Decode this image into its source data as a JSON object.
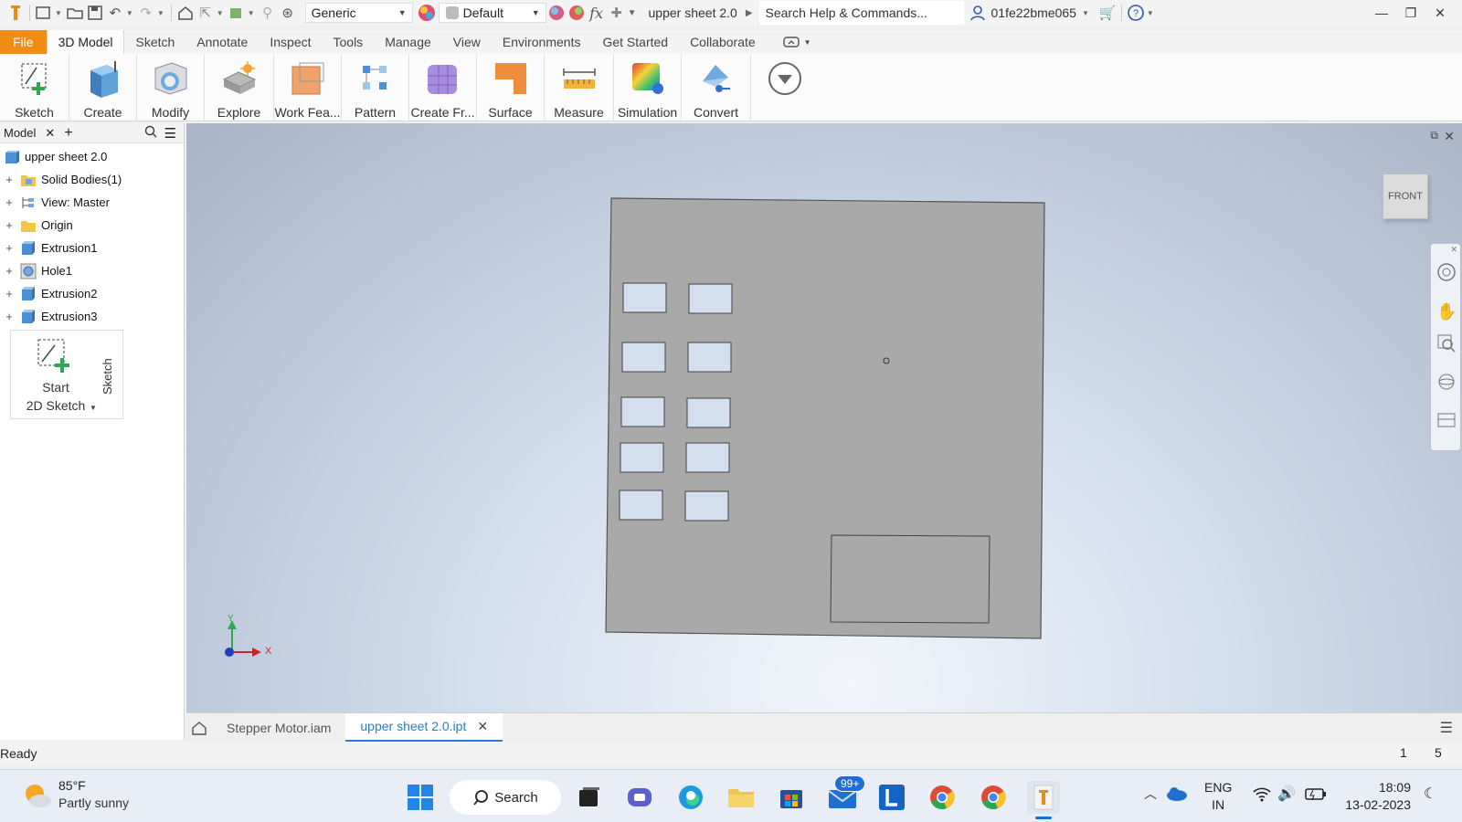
{
  "titlebar": {
    "material": "Generic",
    "appearance": "Default",
    "doc_title": "upper sheet 2.0",
    "search_placeholder": "Search Help & Commands...",
    "user": "01fe22bme065",
    "fx_label": "fx"
  },
  "ribbon_tabs": [
    "File",
    "3D Model",
    "Sketch",
    "Annotate",
    "Inspect",
    "Tools",
    "Manage",
    "View",
    "Environments",
    "Get Started",
    "Collaborate"
  ],
  "ribbon_buttons": [
    "Sketch",
    "Create",
    "Modify",
    "Explore",
    "Work Fea...",
    "Pattern",
    "Create Fr...",
    "Surface",
    "Measure",
    "Simulation",
    "Convert"
  ],
  "browser": {
    "tab_label": "Model",
    "root": "upper sheet 2.0",
    "items": [
      "Solid Bodies(1)",
      "View: Master",
      "Origin",
      "Extrusion1",
      "Hole1",
      "Extrusion2",
      "Extrusion3"
    ],
    "start_sketch_line1": "Start",
    "start_sketch_line2": "2D Sketch",
    "sketch_vertical": "Sketch"
  },
  "viewport": {
    "viewcube_label": "FRONT",
    "axis_y": "Y",
    "axis_x": "X"
  },
  "doc_tabs": [
    "Stepper Motor.iam",
    "upper sheet 2.0.ipt"
  ],
  "status": {
    "text": "Ready",
    "num1": "1",
    "num2": "5"
  },
  "taskbar": {
    "temp": "85°F",
    "weather": "Partly sunny",
    "search": "Search",
    "mail_badge": "99+",
    "lang1": "ENG",
    "lang2": "IN",
    "time": "18:09",
    "date": "13-02-2023"
  }
}
